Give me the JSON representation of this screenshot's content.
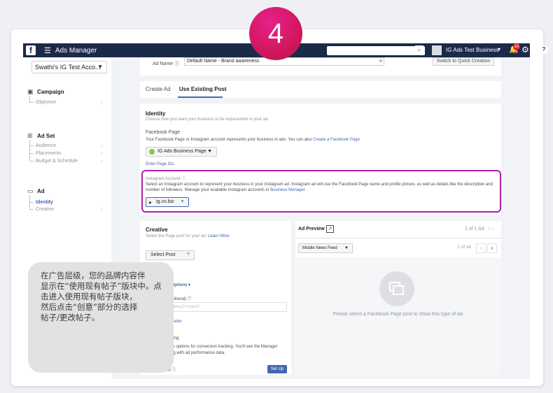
{
  "step": {
    "number": "4"
  },
  "topbar": {
    "title": "Ads Manager",
    "account_name": "IG Ads Test Business",
    "notification_count": "10"
  },
  "sidebar": {
    "account_select": "Swathi's IG Test Acco...",
    "campaign": {
      "title": "Campaign",
      "items": [
        "Objective"
      ]
    },
    "adset": {
      "title": "Ad Set",
      "items": [
        "Audience",
        "Placements",
        "Budget & Schedule"
      ]
    },
    "ad": {
      "title": "Ad",
      "items": [
        "Identity",
        "Creative"
      ]
    }
  },
  "adname": {
    "label": "Ad Name",
    "value": "Default Name - Brand awareness",
    "quick_button": "Switch to Quick Creation"
  },
  "tabs": {
    "create": "Create Ad",
    "existing": "Use Existing Post"
  },
  "identity": {
    "title": "Identity",
    "desc": "Choose how you want your business to be represented in your ad.",
    "fb_page_title": "Facebook Page",
    "fb_page_desc": "Your Facebook Page or Instagram account represents your business in ads. You can also",
    "fb_page_link": "Create a Facebook Page",
    "page_select": "IG Ads Business Page",
    "enter_ids": "Enter Page IDs"
  },
  "instagram": {
    "title": "Instagram Account",
    "desc": "Select an Instagram account to represent your business in your Instagram ad. Instagram ad will use the Facebook Page name and profile picture, as well as details like the description and number of followers. Manage your available Instagram accounts in",
    "link": "Business Manager.",
    "select": "ig.co.biz"
  },
  "creative": {
    "title": "Creative",
    "desc": "Select the Page post for your ad.",
    "learn_more": "Learn More",
    "select_post": "Select Post",
    "advanced": "ed Options ▾",
    "url_label": "e (optional)",
    "url_placeholder": "ue1&key2=value2",
    "param_link": "arameter",
    "tracking_label": "racking",
    "tracking_desc": "more options for conversion tracking. You'll see the Manager along with ad performance data.",
    "pixel_label": "xel",
    "setup": "Set Up"
  },
  "preview": {
    "title": "Ad Preview",
    "count": "1 of 1 Ad",
    "feed_select": "Mobile News Feed",
    "feed_count": "1 of 14",
    "message": "Please select a Facebook Page post to show this type of ad."
  },
  "callout": {
    "text": "在广告层级，您的品牌内容伴\n显示在“使用现有帖子”版块中。点\n击进入使用现有帖子版块，\n然后点击“创意”部分的选择\n帖子/更改帖子。"
  },
  "colors": {
    "topbar": "#1c2a4a",
    "accent": "#4267b2",
    "highlight": "#b01ea5",
    "step": "#e8208a"
  }
}
